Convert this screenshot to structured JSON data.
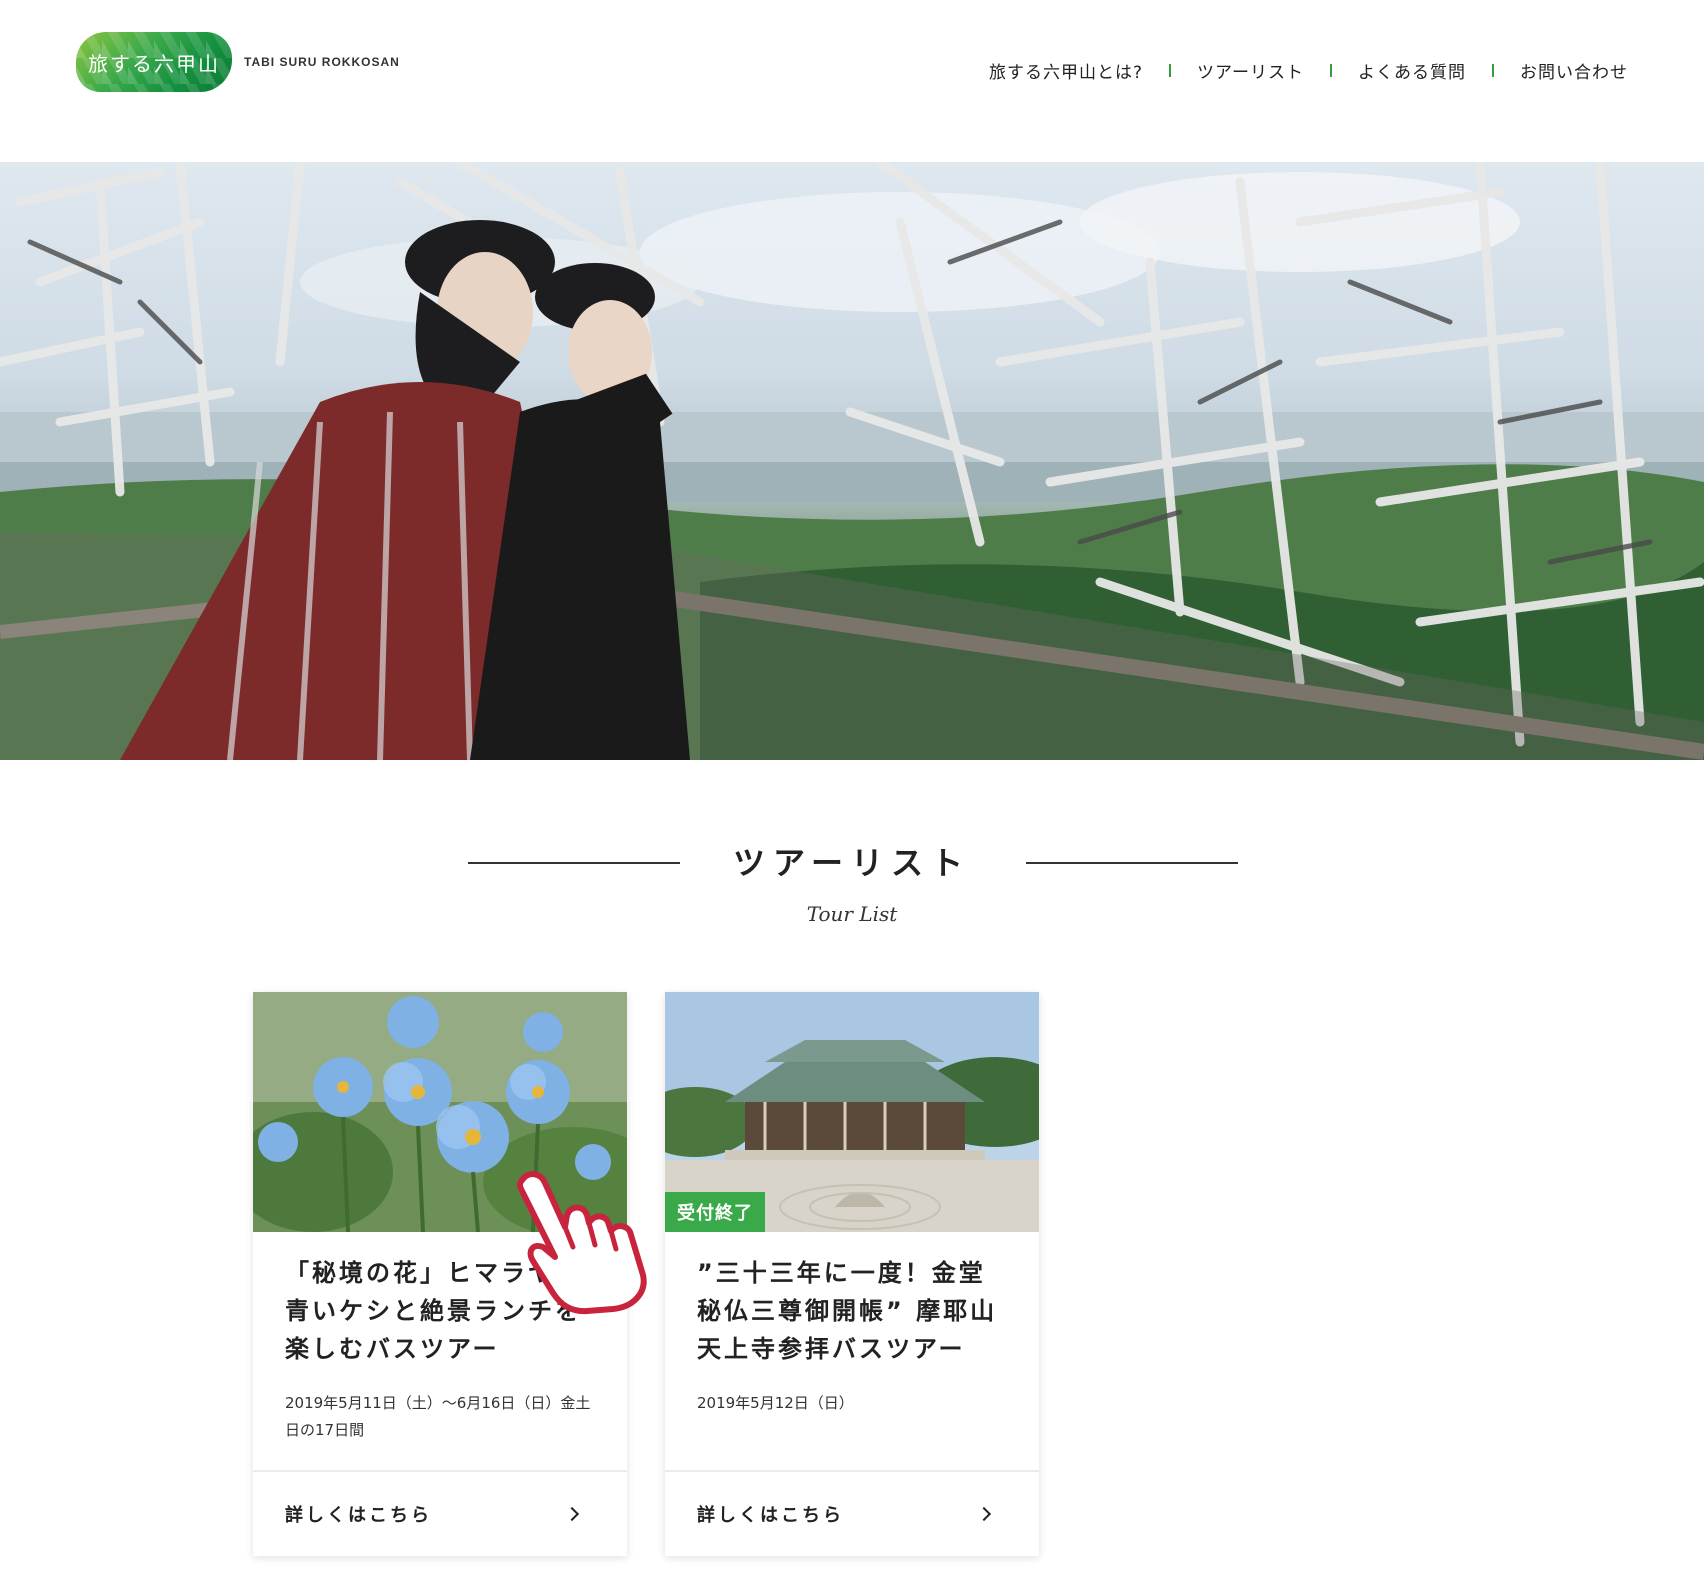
{
  "header": {
    "logo_text": "旅する六甲山",
    "logo_sub": "TABI SURU ROKKOSAN",
    "nav": [
      {
        "label": "旅する六甲山とは?"
      },
      {
        "label": "ツアーリスト"
      },
      {
        "label": "よくある質問"
      },
      {
        "label": "お問い合わせ"
      }
    ]
  },
  "section": {
    "title": "ツアーリスト",
    "subtitle": "Tour List"
  },
  "cards": [
    {
      "title": "「秘境の花」ヒマラヤの青いケシと絶景ランチを楽しむバスツアー",
      "date": "2019年5月11日（土）～6月16日（日）金土日の17日間",
      "link_label": "詳しくはこちら"
    },
    {
      "badge": "受付終了",
      "title": "”三十三年に一度！金堂秘仏三尊御開帳” 摩耶山天上寺参拝バスツアー",
      "date": "2019年5月12日（日）",
      "link_label": "詳しくはこちら"
    }
  ],
  "colors": {
    "brand_green": "#3aa94a",
    "nav_separator": "#3a9a3e",
    "pointer_red": "#c8243d"
  },
  "icons": {
    "chevron": "chevron-right-icon",
    "pointer": "pointing-hand-icon"
  }
}
